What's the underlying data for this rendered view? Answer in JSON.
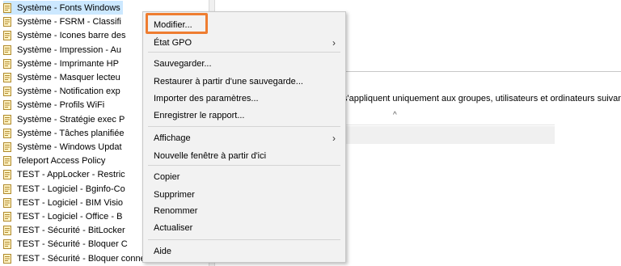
{
  "tree": {
    "items": [
      {
        "label": "Système - Fonts Windows",
        "selected": true
      },
      {
        "label": "Système - FSRM - Classifi"
      },
      {
        "label": "Système - Icones barre des"
      },
      {
        "label": "Système - Impression - Au"
      },
      {
        "label": "Système - Imprimante HP"
      },
      {
        "label": "Système - Masquer lecteu"
      },
      {
        "label": "Système - Notification exp"
      },
      {
        "label": "Système - Profils WiFi"
      },
      {
        "label": "Système - Stratégie exec P"
      },
      {
        "label": "Système - Tâches planifiée"
      },
      {
        "label": "Système - Windows Updat"
      },
      {
        "label": "Teleport Access Policy"
      },
      {
        "label": "TEST - AppLocker - Restric"
      },
      {
        "label": "TEST - Logiciel - Bginfo-Co"
      },
      {
        "label": "TEST - Logiciel - BIM Visio"
      },
      {
        "label": "TEST - Logiciel - Office - B"
      },
      {
        "label": "TEST - Sécurité - BitLocker"
      },
      {
        "label": "TEST - Sécurité - Bloquer C"
      },
      {
        "label": "TEST - Sécurité - Bloquer connexion PC"
      }
    ]
  },
  "right_panel": {
    "filter_text": "s'appliquent uniquement aux groupes, utilisateurs et ordinateurs suivants :",
    "sort_arrow": "^"
  },
  "context_menu": {
    "items": [
      {
        "label": "Modifier...",
        "submenu": false
      },
      {
        "label": "État GPO",
        "submenu": true
      },
      {
        "label": "Sauvegarder...",
        "submenu": false
      },
      {
        "label": "Restaurer à partir d'une sauvegarde...",
        "submenu": false
      },
      {
        "label": "Importer des paramètres...",
        "submenu": false
      },
      {
        "label": "Enregistrer le rapport...",
        "submenu": false
      },
      {
        "label": "Affichage",
        "submenu": true
      },
      {
        "label": "Nouvelle fenêtre à partir d'ici",
        "submenu": false
      },
      {
        "label": "Copier",
        "submenu": false
      },
      {
        "label": "Supprimer",
        "submenu": false
      },
      {
        "label": "Renommer",
        "submenu": false
      },
      {
        "label": "Actualiser",
        "submenu": false
      },
      {
        "label": "Aide",
        "submenu": false
      }
    ],
    "submenu_glyph": "›"
  },
  "colors": {
    "highlight_box": "#ee7d31",
    "selected_row": "#cce8ff",
    "menu_bg": "#f2f2f2"
  }
}
